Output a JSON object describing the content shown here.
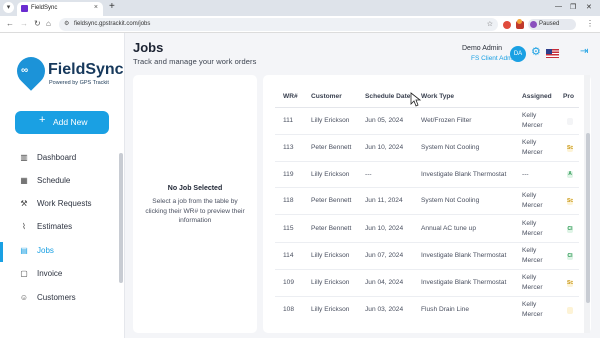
{
  "browser": {
    "tab_title": "FieldSync",
    "url": "fieldsync.gpstrackit.com/jobs",
    "profile_label": "Paused"
  },
  "brand": {
    "name": "FieldSync",
    "tagline": "Powered by GPS Trackit",
    "accent": "#1aa0e3"
  },
  "sidebar": {
    "add_new": "Add New",
    "items": [
      {
        "label": "Dashboard",
        "icon": "bar-chart-icon"
      },
      {
        "label": "Schedule",
        "icon": "calendar-icon"
      },
      {
        "label": "Work Requests",
        "icon": "wrench-icon"
      },
      {
        "label": "Estimates",
        "icon": "paperclip-icon"
      },
      {
        "label": "Jobs",
        "icon": "briefcase-icon",
        "active": true
      },
      {
        "label": "Invoice",
        "icon": "document-icon"
      },
      {
        "label": "Customers",
        "icon": "people-icon"
      }
    ]
  },
  "header": {
    "title": "Jobs",
    "subtitle": "Track and manage your work orders",
    "user_name": "Demo Admin",
    "user_role": "FS Client Admin",
    "avatar_initials": "DA"
  },
  "preview": {
    "title": "No Job Selected",
    "text": "Select a job from the table by clicking their WR# to preview their information"
  },
  "table": {
    "columns": [
      "WR#",
      "Customer",
      "Schedule Date",
      "Work Type",
      "Assigned",
      "Pro"
    ],
    "rows": [
      {
        "wr": "111",
        "customer": "Lilly Erickson",
        "date": "Jun 05, 2024",
        "work_type": "Wet/Frozen Filter",
        "assigned": "Kelly Mercer",
        "status_color": "#f3f4f6",
        "status_text": ""
      },
      {
        "wr": "113",
        "customer": "Peter Bennett",
        "date": "Jun 10, 2024",
        "work_type": "System Not Cooling",
        "assigned": "Kelly Mercer",
        "status_color": "#fdf3d6",
        "status_text": "Sc"
      },
      {
        "wr": "119",
        "customer": "Lilly Erickson",
        "date": "---",
        "work_type": "Investigate Blank Thermostat",
        "assigned": "---",
        "status_color": "#dff4e6",
        "status_text": "A"
      },
      {
        "wr": "118",
        "customer": "Peter Bennett",
        "date": "Jun 11, 2024",
        "work_type": "System Not Cooling",
        "assigned": "Kelly Mercer",
        "status_color": "#fdf3d6",
        "status_text": "Sc"
      },
      {
        "wr": "115",
        "customer": "Peter Bennett",
        "date": "Jun 10, 2024",
        "work_type": "Annual AC tune up",
        "assigned": "Kelly Mercer",
        "status_color": "#dff4e6",
        "status_text": "Cl"
      },
      {
        "wr": "114",
        "customer": "Lilly Erickson",
        "date": "Jun 07, 2024",
        "work_type": "Investigate Blank Thermostat",
        "assigned": "Kelly Mercer",
        "status_color": "#dff4e6",
        "status_text": "Cl"
      },
      {
        "wr": "109",
        "customer": "Lilly Erickson",
        "date": "Jun 04, 2024",
        "work_type": "Investigate Blank Thermostat",
        "assigned": "Kelly Mercer",
        "status_color": "#fdf3d6",
        "status_text": "Sc"
      },
      {
        "wr": "108",
        "customer": "Lilly Erickson",
        "date": "Jun 03, 2024",
        "work_type": "Flush Drain Line",
        "assigned": "Kelly Mercer",
        "status_color": "#fdf3d6",
        "status_text": ""
      }
    ]
  }
}
